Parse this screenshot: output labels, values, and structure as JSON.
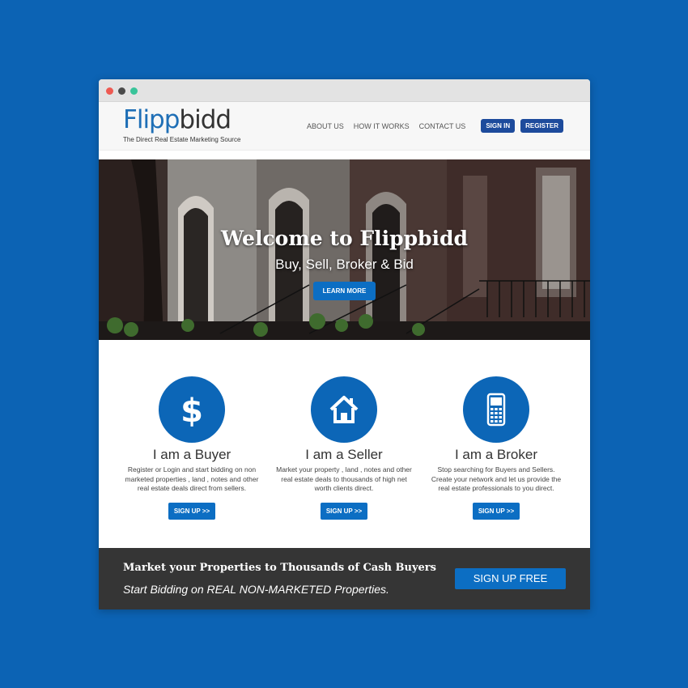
{
  "brand": {
    "logo_part1": "Flipp",
    "logo_part2": "bidd",
    "tagline": "The Direct Real Estate Marketing Source"
  },
  "nav": {
    "links": [
      "ABOUT US",
      "HOW IT WORKS",
      "CONTACT US"
    ],
    "sign_in": "SIGN IN",
    "register": "REGISTER"
  },
  "hero": {
    "title": "Welcome to Flippbidd",
    "subtitle": "Buy, Sell, Broker & Bid",
    "button": "LEARN MORE"
  },
  "features": [
    {
      "icon": "dollar-icon",
      "title": "I am a Buyer",
      "text": "Register or Login and start bidding on non marketed properties , land , notes and other real estate deals direct from sellers.",
      "button": "SIGN UP >>"
    },
    {
      "icon": "house-icon",
      "title": "I am a Seller",
      "text": "Market your property , land , notes and other real estate deals to thousands of high net worth clients direct.",
      "button": "SIGN UP >>"
    },
    {
      "icon": "mobile-phone-icon",
      "title": "I am a Broker",
      "text": "Stop searching for Buyers and Sellers. Create your network and let us provide the real estate professionals to you direct.",
      "button": "SIGN UP >>"
    }
  ],
  "cta": {
    "title": "Market your Properties to Thousands of Cash Buyers",
    "subtitle": "Start Bidding on REAL NON-MARKETED Properties.",
    "button": "SIGN UP FREE"
  },
  "colors": {
    "background": "#0c63b4",
    "accent": "#0c6ec3",
    "nav_button": "#1d4b9c",
    "footer": "#353535"
  }
}
